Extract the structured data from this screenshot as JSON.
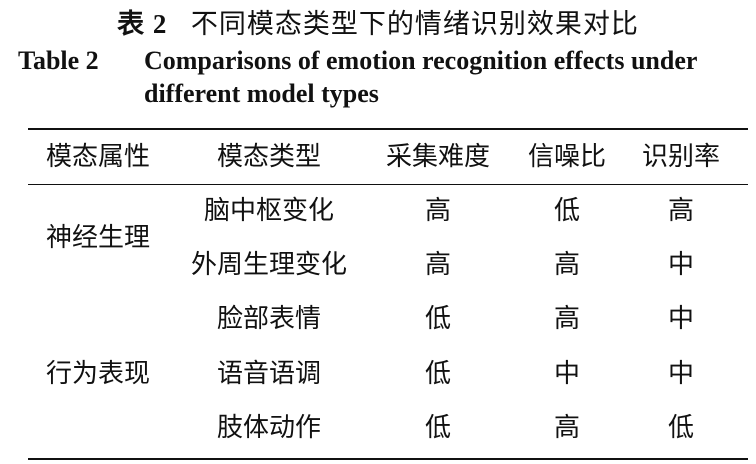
{
  "caption": {
    "cn_label": "表 2",
    "cn_title": "不同模态类型下的情绪识别效果对比",
    "en_label": "Table 2",
    "en_title_line1": "Comparisons of emotion recognition effects under",
    "en_title_line2": "different model types"
  },
  "table": {
    "headers": [
      "模态属性",
      "模态类型",
      "采集难度",
      "信噪比",
      "识别率"
    ],
    "groups": [
      "神经生理",
      "行为表现"
    ],
    "rows": [
      {
        "type": "脑中枢变化",
        "difficulty": "高",
        "snr": "低",
        "rate": "高"
      },
      {
        "type": "外周生理变化",
        "difficulty": "高",
        "snr": "高",
        "rate": "中"
      },
      {
        "type": "脸部表情",
        "difficulty": "低",
        "snr": "高",
        "rate": "中"
      },
      {
        "type": "语音语调",
        "difficulty": "低",
        "snr": "中",
        "rate": "中"
      },
      {
        "type": "肢体动作",
        "difficulty": "低",
        "snr": "高",
        "rate": "低"
      }
    ]
  }
}
